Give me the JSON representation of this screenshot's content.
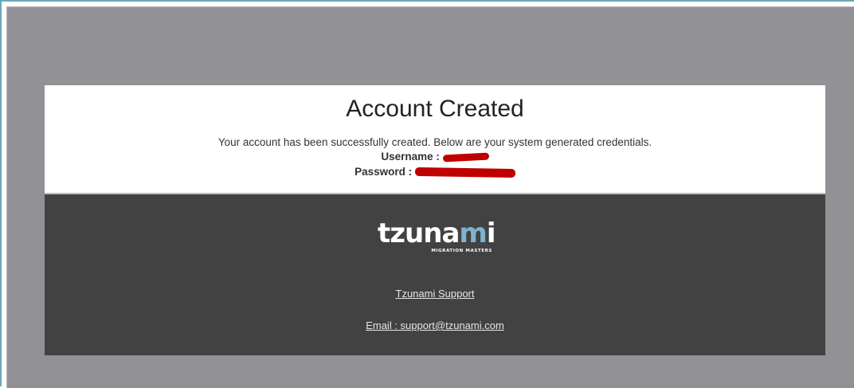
{
  "dialog": {
    "title": "Account Created",
    "message": "Your account has been successfully created. Below are your system generated credentials.",
    "username_label": "Username :",
    "password_label": "Password :"
  },
  "footer": {
    "logo_text": "tzunami",
    "logo_tagline": "MIGRATION MASTERS",
    "support_link": "Tzunami Support",
    "email_link": "Email : support@tzunami.com"
  },
  "colors": {
    "backdrop": "#929196",
    "card_top": "#ffffff",
    "card_bottom": "#424242",
    "logo_accent": "#7fb2cf",
    "redaction": "#c00000"
  }
}
